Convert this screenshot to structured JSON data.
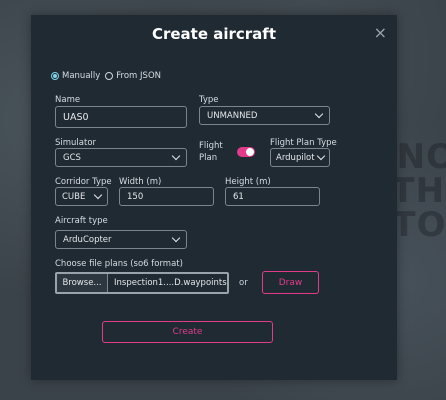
{
  "dialog": {
    "title": "Create aircraft",
    "close_glyph": "×"
  },
  "mode": {
    "options": [
      {
        "label": "Manually",
        "selected": true
      },
      {
        "label": "From JSON",
        "selected": false
      }
    ]
  },
  "form": {
    "name": {
      "label": "Name",
      "value": "UAS0"
    },
    "type": {
      "label": "Type",
      "value": "UNMANNED"
    },
    "simulator": {
      "label": "Simulator",
      "value": "GCS"
    },
    "flight_plan": {
      "label_line1": "Flight",
      "label_line2": "Plan",
      "enabled": true
    },
    "flight_plan_type": {
      "label": "Flight Plan Type",
      "value": "Ardupilot"
    },
    "corridor_type": {
      "label": "Corridor Type",
      "value": "CUBE"
    },
    "width": {
      "label": "Width (m)",
      "value": "150"
    },
    "height": {
      "label": "Height (m)",
      "value": "61"
    },
    "aircraft_type": {
      "label": "Aircraft type",
      "value": "ArduCopter"
    },
    "file_plans": {
      "label": "Choose file plans (so6 format)",
      "browse_label": "Browse...",
      "file_name": "Inspection1....D.waypoints",
      "or_label": "or",
      "draw_label": "Draw"
    }
  },
  "actions": {
    "create_label": "Create"
  },
  "colors": {
    "accent": "#e23b8c",
    "radio_selected": "#7fd3ea",
    "dialog_bg": "#1f2a33"
  }
}
